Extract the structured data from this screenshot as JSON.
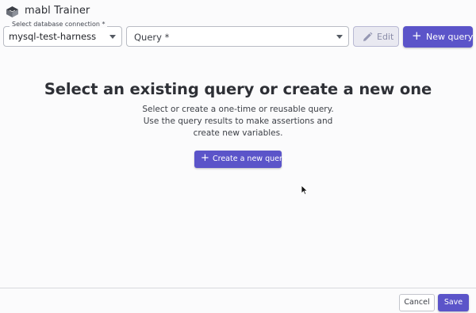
{
  "app": {
    "title": "mabl Trainer",
    "logo_icon": "mabl-logo-icon"
  },
  "toolbar": {
    "db_connection": {
      "label": "Select database connection *",
      "value": "mysql-test-harness"
    },
    "query": {
      "placeholder": "Query *"
    },
    "edit_label": "Edit",
    "edit_icon": "pencil-icon",
    "new_query_label": "New query",
    "new_query_icon": "plus-icon"
  },
  "main": {
    "heading": "Select an existing query or create a new one",
    "description": "Select or create a one-time or reusable query. Use the query results to make assertions and create new variables.",
    "create_button_label": "Create a new query"
  },
  "footer": {
    "cancel_label": "Cancel",
    "save_label": "Save"
  },
  "colors": {
    "primary": "#5b54c9",
    "disabled_bg": "#e9e9f1",
    "background": "#fbfbfc"
  }
}
